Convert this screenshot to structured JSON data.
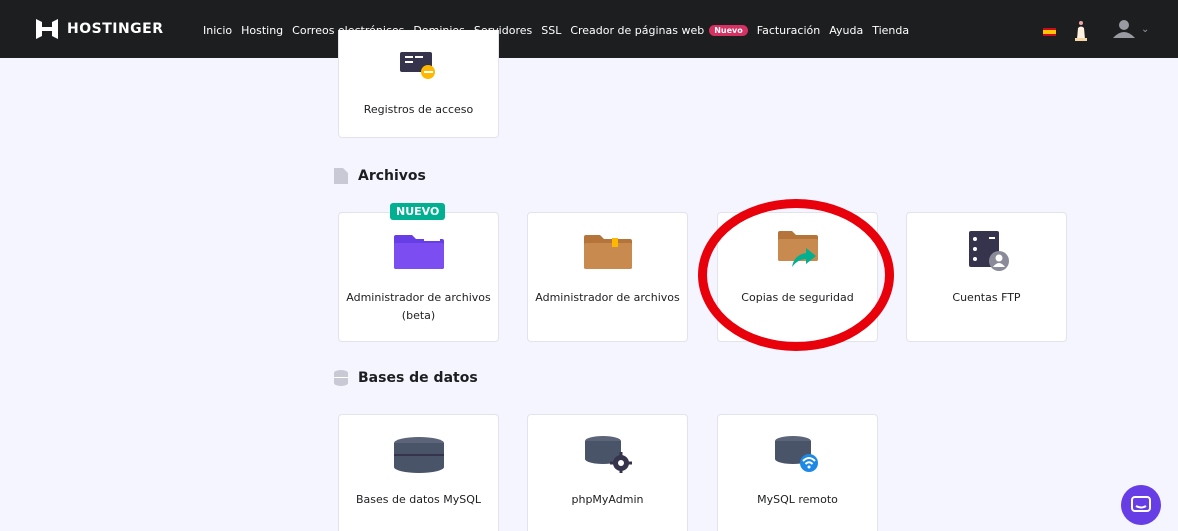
{
  "brand": {
    "name": "HOSTINGER"
  },
  "nav": {
    "items": [
      "Inicio",
      "Hosting",
      "Correos electrónicos",
      "Dominios",
      "Servidores",
      "SSL",
      "Creador de páginas web"
    ],
    "builder_badge": "Nuevo",
    "items_after": [
      "Facturación",
      "Ayuda",
      "Tienda"
    ]
  },
  "top_card": {
    "label": "Registros de acceso"
  },
  "sections": {
    "files": {
      "title": "Archivos",
      "badge": "NUEVO",
      "cards": [
        "Administrador de archivos (beta)",
        "Administrador de archivos",
        "Copias de seguridad",
        "Cuentas FTP"
      ]
    },
    "databases": {
      "title": "Bases de datos",
      "cards": [
        "Bases de datos MySQL",
        "phpMyAdmin",
        "MySQL remoto"
      ]
    }
  },
  "colors": {
    "accent": "#673de6",
    "highlight": "#e8000b",
    "badge": "#00b090"
  }
}
